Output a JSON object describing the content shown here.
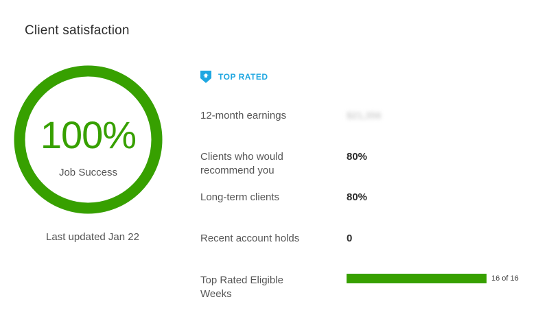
{
  "header": {
    "title": "Client satisfaction"
  },
  "job_success": {
    "percent_text": "100%",
    "value": 100,
    "label": "Job Success",
    "last_updated": "Last updated Jan 22",
    "color": "#37a000"
  },
  "badge": {
    "text": "TOP RATED",
    "icon": "top-rated-shield-icon",
    "color": "#1fa7e1"
  },
  "stats": {
    "earnings": {
      "label": "12-month earnings",
      "value": "$21,356"
    },
    "recommend": {
      "label_line1": "Clients who would",
      "label_line2": "recommend you",
      "value": "80%"
    },
    "long_term": {
      "label": "Long-term clients",
      "value": "80%"
    },
    "holds": {
      "label": "Recent account holds",
      "value": "0"
    },
    "eligible_weeks": {
      "label_line1": "Top Rated Eligible",
      "label_line2": "Weeks",
      "count_text": "16 of 16",
      "fraction": 1.0
    }
  }
}
